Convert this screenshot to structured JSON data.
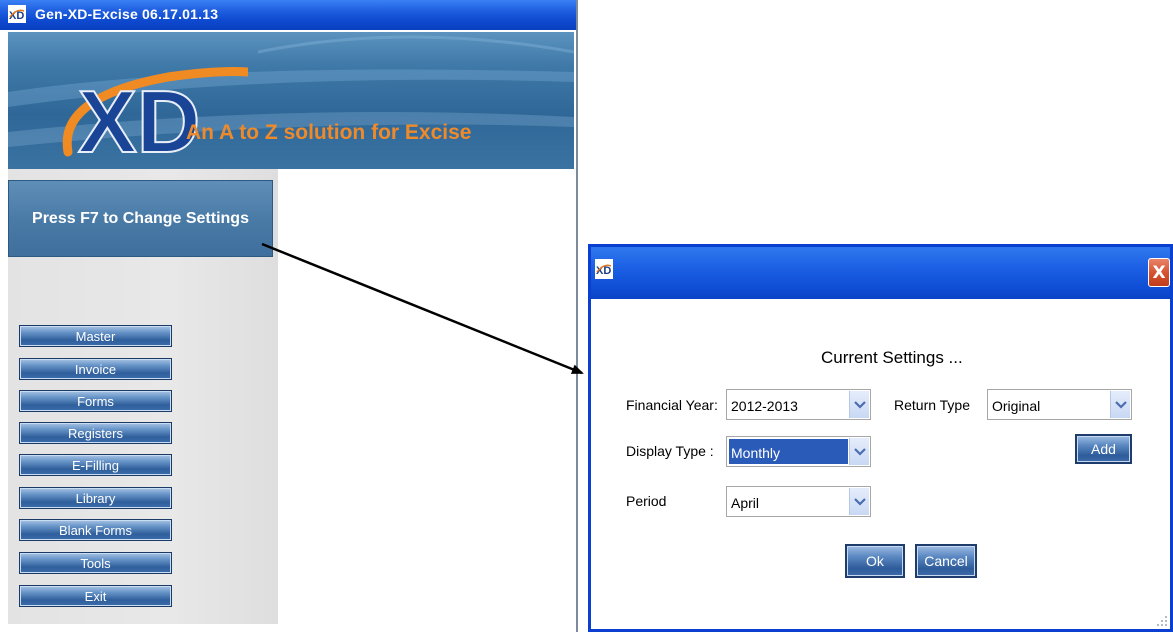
{
  "main_window": {
    "title": "Gen-XD-Excise 06.17.01.13",
    "banner": {
      "logo_text": "XD",
      "tagline": "An A to Z solution for Excise"
    },
    "settings_hint": "Press F7 to Change Settings",
    "menu": [
      {
        "label": "Master"
      },
      {
        "label": "Invoice"
      },
      {
        "label": "Forms"
      },
      {
        "label": "Registers"
      },
      {
        "label": "E-Filling"
      },
      {
        "label": "Library"
      },
      {
        "label": "Blank Forms"
      },
      {
        "label": "Tools"
      },
      {
        "label": "Exit"
      }
    ]
  },
  "dialog": {
    "close_glyph": "X",
    "heading": "Current Settings ...",
    "fields": {
      "financial_year": {
        "label": "Financial Year:",
        "value": "2012-2013"
      },
      "return_type": {
        "label": "Return Type",
        "value": "Original"
      },
      "display_type": {
        "label": "Display Type :",
        "value": "Monthly"
      },
      "period": {
        "label": "Period",
        "value": "April"
      }
    },
    "buttons": {
      "add": "Add",
      "ok": "Ok",
      "cancel": "Cancel"
    }
  },
  "colors": {
    "titlebar_blue": "#0d49cf",
    "banner_blue": "#3f79a8",
    "tagline_orange": "#ee8a2a",
    "menu_button_blue": "#2f5f9c",
    "selection_blue": "#2b5bb8",
    "close_red": "#d65432"
  },
  "icons": {
    "app_icon": "xd-app-icon",
    "dropdown": "chevron-down-icon",
    "close": "close-icon",
    "resize": "resize-grip-icon"
  }
}
